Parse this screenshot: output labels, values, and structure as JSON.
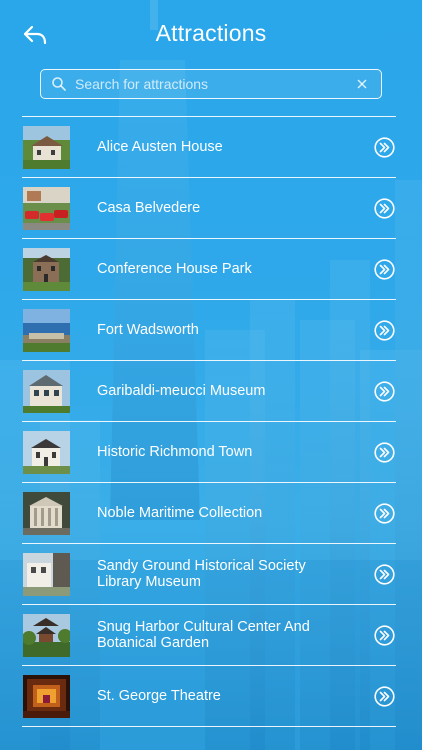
{
  "header": {
    "title": "Attractions"
  },
  "search": {
    "placeholder": "Search for attractions"
  },
  "colors": {
    "background": "#2ea8ea",
    "text": "#ffffff",
    "divider": "#ffffff"
  },
  "icons": {
    "back": "back-arrow-icon",
    "search": "search-icon",
    "clear": "close-icon",
    "row_action": "double-chevron-right-icon"
  },
  "attractions": [
    {
      "name": "Alice Austen House",
      "thumb": "house-photo"
    },
    {
      "name": "Casa Belvedere",
      "thumb": "cars-photo"
    },
    {
      "name": "Conference House Park",
      "thumb": "stone-house-photo"
    },
    {
      "name": "Fort Wadsworth",
      "thumb": "harbor-view-photo"
    },
    {
      "name": "Garibaldi-meucci Museum",
      "thumb": "museum-house-photo"
    },
    {
      "name": "Historic Richmond Town",
      "thumb": "white-house-photo"
    },
    {
      "name": "Noble Maritime Collection",
      "thumb": "columned-building-photo"
    },
    {
      "name": "Sandy Ground Historical Society Library Museum",
      "thumb": "library-photo"
    },
    {
      "name": "Snug Harbor Cultural Center And Botanical Garden",
      "thumb": "pagoda-garden-photo"
    },
    {
      "name": "St. George Theatre",
      "thumb": "theatre-interior-photo"
    }
  ]
}
